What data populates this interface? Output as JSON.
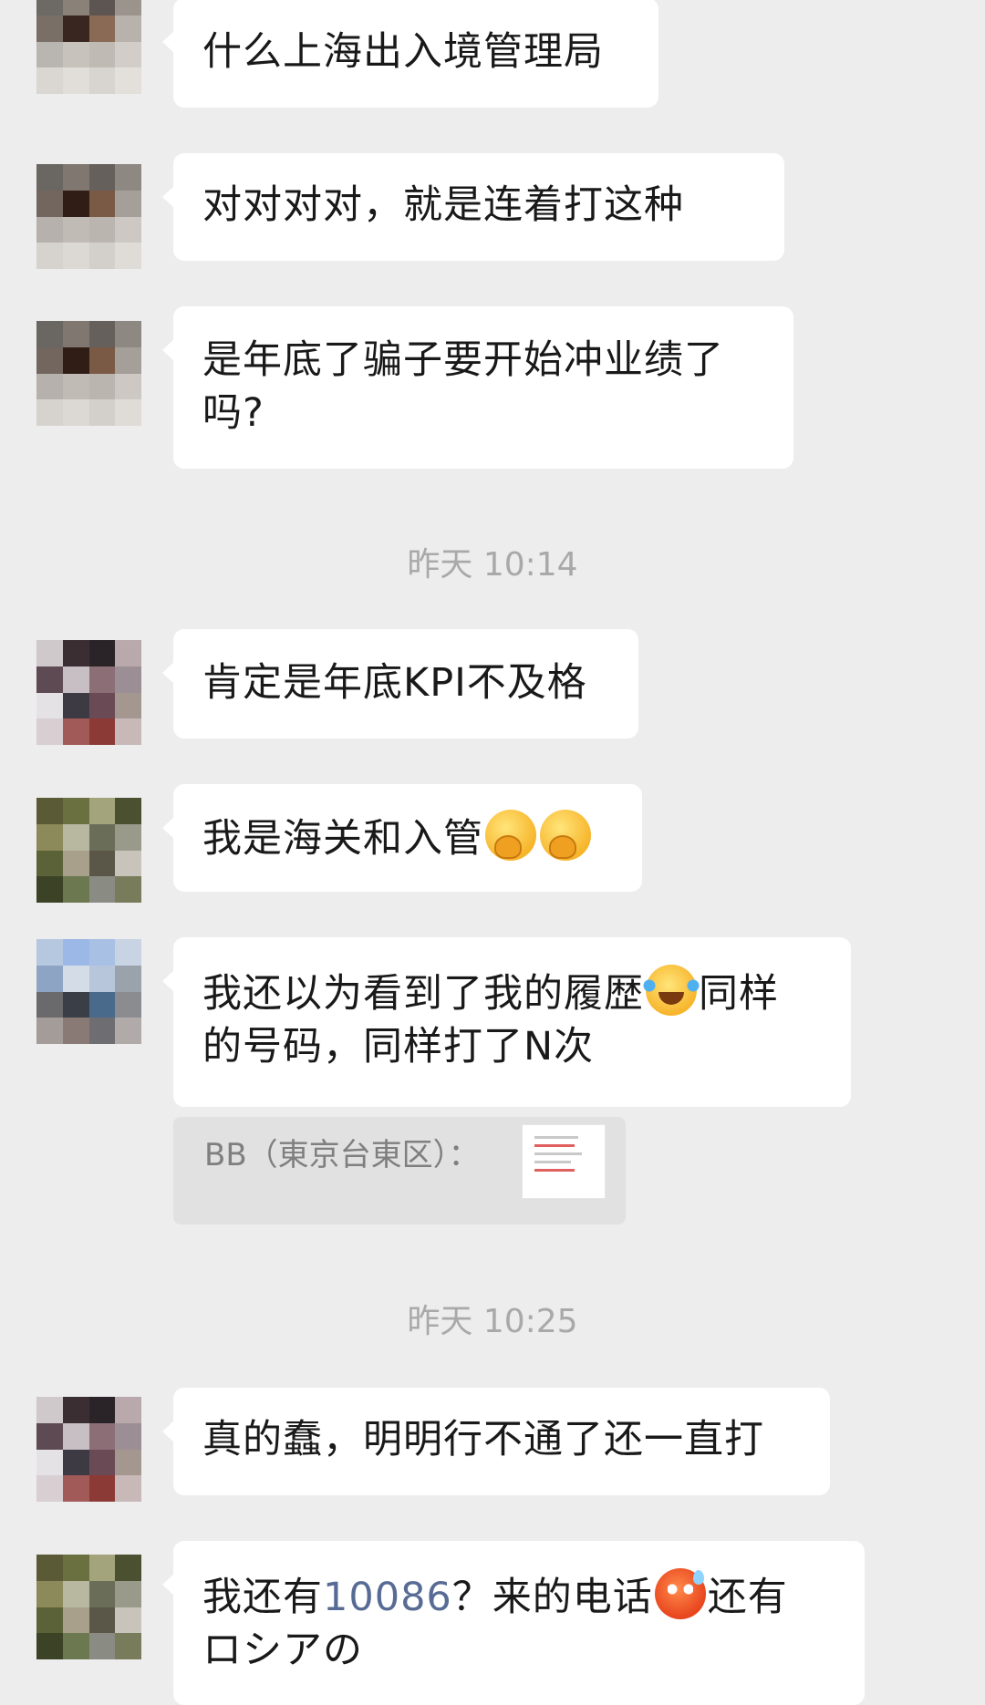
{
  "messages": [
    {
      "type": "text",
      "text": "什么上海出入境管理局"
    },
    {
      "type": "text",
      "text": "对对对对，就是连着打这种"
    },
    {
      "type": "text",
      "line1": "是年底了骗子要开始冲业绩了",
      "line2": "吗?"
    },
    {
      "type": "timestamp",
      "text": "昨天 10:14"
    },
    {
      "type": "text",
      "text": "肯定是年底KPI不及格"
    },
    {
      "type": "text",
      "text": "我是海关和入管",
      "emojis": [
        "hand-over-mouth-emoji",
        "hand-over-mouth-emoji"
      ]
    },
    {
      "type": "text",
      "line1_a": "我还以为看到了我的履歴",
      "emoji": "tears-of-joy-emoji",
      "line1_b": "同样",
      "line2": "的号码，同样打了N次"
    },
    {
      "type": "quote",
      "text": "BB（東京台東区）：",
      "thumbnail": "call-log-screenshot"
    },
    {
      "type": "timestamp",
      "text": "昨天 10:25"
    },
    {
      "type": "text",
      "text": "真的蠢，明明行不通了还一直打"
    },
    {
      "type": "text",
      "line1_a": "我还有",
      "number": "10086",
      "line1_b": "？来的电话",
      "emoji": "sweating-red-face-emoji",
      "line1_c": "还有",
      "line2": "ロシアの"
    }
  ]
}
